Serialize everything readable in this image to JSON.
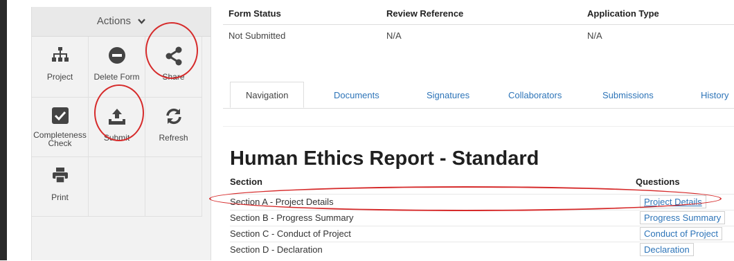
{
  "actions": {
    "title": "Actions",
    "items": [
      {
        "label": "Project",
        "icon": "sitemap-icon"
      },
      {
        "label": "Delete Form",
        "icon": "minus-circle-icon"
      },
      {
        "label": "Share",
        "icon": "share-icon"
      },
      {
        "label": "Completeness Check",
        "icon": "checkbox-icon"
      },
      {
        "label": "Submit",
        "icon": "upload-icon"
      },
      {
        "label": "Refresh",
        "icon": "refresh-icon"
      },
      {
        "label": "Print",
        "icon": "print-icon"
      }
    ]
  },
  "info": {
    "headers": [
      "Form Status",
      "Review Reference",
      "Application Type"
    ],
    "values": [
      "Not Submitted",
      "N/A",
      "N/A"
    ]
  },
  "tabs": [
    "Navigation",
    "Documents",
    "Signatures",
    "Collaborators",
    "Submissions",
    "History"
  ],
  "report": {
    "title": "Human Ethics Report - Standard",
    "section_header": "Section",
    "questions_header": "Questions",
    "rows": [
      {
        "section": "Section A - Project Details",
        "question": "Project Details"
      },
      {
        "section": "Section B - Progress Summary",
        "question": "Progress Summary"
      },
      {
        "section": "Section C - Conduct of Project",
        "question": "Conduct of Project"
      },
      {
        "section": "Section D - Declaration",
        "question": "Declaration"
      }
    ]
  },
  "colors": {
    "accent": "#2d74b8",
    "annotation": "#d62b2b"
  }
}
